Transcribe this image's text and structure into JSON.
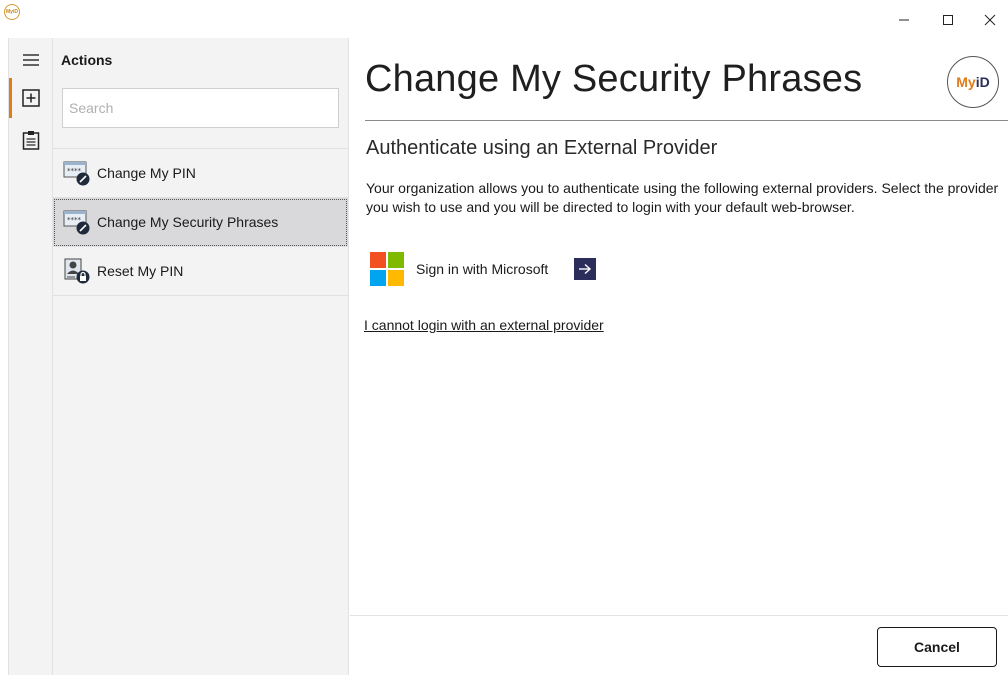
{
  "window": {
    "app_icon_text": "MyiD",
    "minimize_icon": "minimize-icon",
    "maximize_icon": "maximize-icon",
    "close_icon": "close-icon"
  },
  "rail": {
    "items": [
      {
        "icon": "hamburger-menu-icon"
      },
      {
        "icon": "add-box-icon"
      },
      {
        "icon": "clipboard-icon"
      }
    ],
    "accent_color": "#e07b1a"
  },
  "actions": {
    "title": "Actions",
    "search_placeholder": "Search",
    "items": [
      {
        "label": "Change My PIN",
        "icon": "pin-edit-icon",
        "selected": false
      },
      {
        "label": "Change My Security Phrases",
        "icon": "pin-edit-icon",
        "selected": true
      },
      {
        "label": "Reset My PIN",
        "icon": "user-lock-icon",
        "selected": false
      }
    ]
  },
  "main": {
    "title": "Change My Security Phrases",
    "logo": {
      "my": "My",
      "id": "iD"
    },
    "subtitle": "Authenticate using an External Provider",
    "description": "Your organization allows you to authenticate using the following external providers. Select the provider you wish to use and you will be directed to login with your default web-browser.",
    "provider": {
      "label": "Sign in with Microsoft",
      "icon": "microsoft-logo-icon",
      "action_icon": "arrow-right-icon"
    },
    "external_link": "I cannot login with an external provider",
    "cancel_label": "Cancel"
  },
  "colors": {
    "brand_orange": "#e07b1a",
    "brand_navy": "#2b2d5a",
    "panel_bg": "#f3f3f3",
    "selected_bg": "#d9d9dc"
  }
}
